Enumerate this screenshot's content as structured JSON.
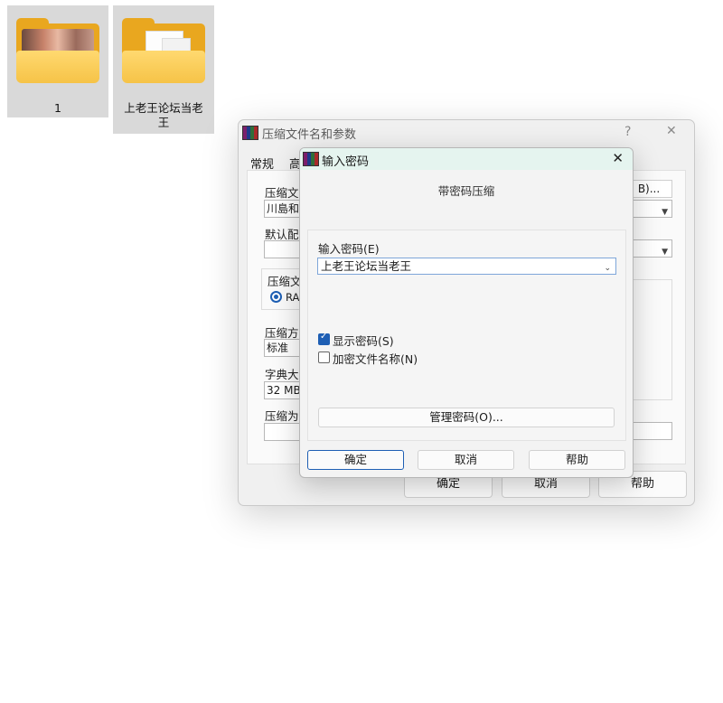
{
  "desktop": {
    "icons": [
      {
        "label": "1",
        "kind": "photo-folder-icon"
      },
      {
        "label": "上老王论坛当老王",
        "kind": "document-folder-icon"
      }
    ]
  },
  "main_dialog": {
    "title": "压缩文件名和参数",
    "help_glyph": "?",
    "close_glyph": "✕",
    "tabs": [
      "常规",
      "高"
    ],
    "archive_name_label": "压缩文",
    "archive_name_value": "川島和",
    "browse_label": "B)...",
    "default_profile_label": "默认配",
    "archive_format_label": "压缩文",
    "format_option": "RA",
    "method_label": "压缩方",
    "method_value": "标准",
    "dictionary_label": "字典大",
    "dictionary_value": "32 MB",
    "split_label": "压缩为",
    "ok": "确定",
    "cancel": "取消",
    "help": "帮助"
  },
  "password_dialog": {
    "title": "输入密码",
    "close_glyph": "✕",
    "heading": "带密码压缩",
    "password_label": "输入密码(E)",
    "password_value": "上老王论坛当老王",
    "show_password": {
      "label": "显示密码(S)",
      "checked": true
    },
    "encrypt_names": {
      "label": "加密文件名称(N)",
      "checked": false
    },
    "manage_button": "管理密码(O)...",
    "ok": "确定",
    "cancel": "取消",
    "help": "帮助"
  }
}
